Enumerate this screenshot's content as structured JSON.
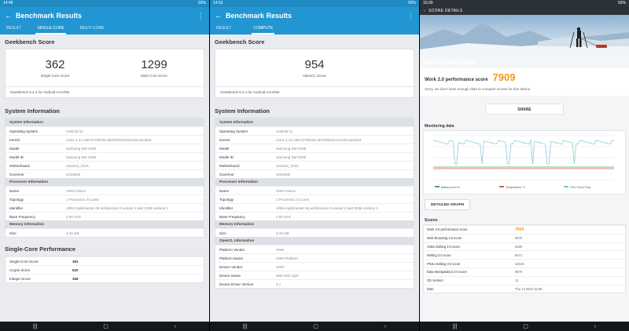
{
  "colors": {
    "accent": "#2196d3",
    "orange": "#f39a1c",
    "navbar": "#15181b"
  },
  "p1": {
    "time": "14:48",
    "battery": "93%",
    "title": "Benchmark Results",
    "tabs": [
      "RESULT",
      "SINGLE-CORE",
      "MULTI-CORE"
    ],
    "score_section": "Geekbench Score",
    "scores": [
      {
        "value": "362",
        "label": "Single-Core Score"
      },
      {
        "value": "1299",
        "label": "Multi-Core Score"
      }
    ],
    "footnote": "Geekbench 5.4.4 for Android AArch64",
    "sys_title": "System Information",
    "sys_info": [
      {
        "header": "System Information",
        "rows": [
          [
            "Operating System",
            "Android 11"
          ],
          [
            "Kernel",
            "Linux 4.14.199-22795182-abX205XXU3AUJ8 aarch64"
          ],
          [
            "Model",
            "samsung SM-X205"
          ],
          [
            "Model ID",
            "samsung SM-X205"
          ],
          [
            "Motherboard",
            "ums512_1h10"
          ],
          [
            "Governor",
            "schedutil"
          ]
        ]
      },
      {
        "header": "Processor Information",
        "rows": [
          [
            "Name",
            "ARM Unisoc"
          ],
          [
            "Topology",
            "1 Processor, 8 Cores"
          ],
          [
            "Identifier",
            "ARM implementer 65 architecture 8 variant 2 part 3338 revision 1"
          ],
          [
            "Base Frequency",
            "2.00 GHz"
          ]
        ]
      },
      {
        "header": "Memory Information",
        "rows": [
          [
            "Size",
            "3.43 GB"
          ]
        ]
      }
    ],
    "perf_title": "Single-Core Performance",
    "perf_rows": [
      [
        "Single-Core Score",
        "362"
      ],
      [
        "Crypto Score",
        "620"
      ],
      [
        "Integer Score",
        "358"
      ]
    ]
  },
  "p2": {
    "time": "14:52",
    "battery": "93%",
    "title": "Benchmark Results",
    "tabs": [
      "RESULT",
      "COMPUTE"
    ],
    "score_section": "Geekbench Score",
    "score": {
      "value": "954",
      "label": "OpenCL Score"
    },
    "footnote": "Geekbench 5.4.4 for Android AArch64",
    "sys_title": "System Information",
    "sys_info": [
      {
        "header": "System Information",
        "rows": [
          [
            "Operating System",
            "Android 11"
          ],
          [
            "Kernel",
            "Linux 4.14.199-22795182-abX205XXU3AUJ8 aarch64"
          ],
          [
            "Model",
            "samsung SM-X205"
          ],
          [
            "Model ID",
            "samsung SM-X205"
          ],
          [
            "Motherboard",
            "ums512_1h10"
          ],
          [
            "Governor",
            "schedutil"
          ]
        ]
      },
      {
        "header": "Processor Information",
        "rows": [
          [
            "Name",
            "ARM Unisoc"
          ],
          [
            "Topology",
            "1 Processor, 8 Cores"
          ],
          [
            "Identifier",
            "ARM implementer 65 architecture 8 variant 2 part 3338 revision 1"
          ],
          [
            "Base Frequency",
            "2.00 GHz"
          ]
        ]
      },
      {
        "header": "Memory Information",
        "rows": [
          [
            "Size",
            "3.43 GB"
          ]
        ]
      },
      {
        "header": "OpenCL Information",
        "rows": [
          [
            "Platform Vendor",
            "ARM"
          ],
          [
            "Platform Name",
            "ARM Platform"
          ],
          [
            "Device Vendor",
            "ARM"
          ],
          [
            "Device Name",
            "Mali-G52 r1p0"
          ],
          [
            "Device Driver Version",
            "2.1"
          ]
        ]
      }
    ]
  },
  "p3": {
    "time": "15:09",
    "battery": "93%",
    "header": "SCORE DETAILS",
    "hero_title": "Work 3.0 performance",
    "hero_version": "v1",
    "perf_label": "Work 3.0 performance score",
    "perf_value": "7909",
    "note": "Sorry, we don't have enough data to compare scores for this device.",
    "share": "SHARE",
    "monitoring_title": "Monitoring data",
    "legend": [
      "Battery level %",
      "Temperature °C",
      "CPU Clock Freq"
    ],
    "detail_button": "DETAILED GRAPH",
    "scores_title": "Scores",
    "scores": [
      [
        "Work 3.0 performance score",
        "7909"
      ],
      [
        "Web Browsing 3.0 score",
        "6875"
      ],
      [
        "Video Editing 3.0 score",
        "5329"
      ],
      [
        "Writing 3.0 score",
        "8471"
      ],
      [
        "Photo Editing 3.0 score",
        "14843"
      ],
      [
        "Data Manipulation 3.0 score",
        "6679"
      ],
      [
        "OS Version",
        "11"
      ],
      [
        "Date",
        "Thu 13 2022 15:09"
      ]
    ]
  }
}
